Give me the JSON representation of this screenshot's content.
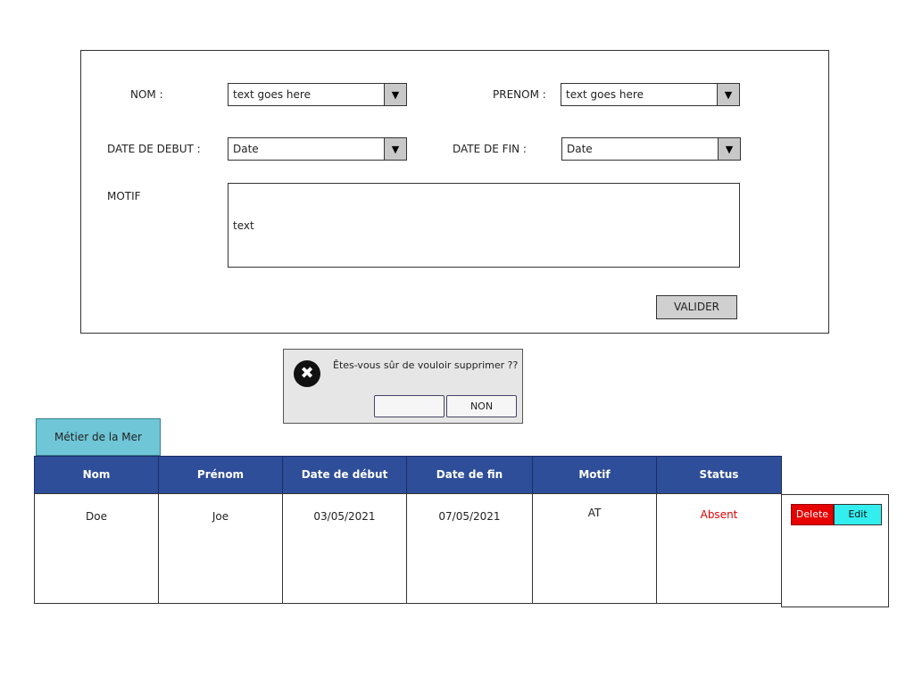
{
  "form": {
    "nom_label": "NOM :",
    "nom_value": "text goes here",
    "prenom_label": "PRENOM :",
    "prenom_value": "text goes here",
    "date_debut_label": "DATE DE DEBUT :",
    "date_debut_value": "Date",
    "date_fin_label": "DATE DE FIN :",
    "date_fin_value": "Date",
    "motif_label": "MOTIF",
    "motif_value": "text",
    "dropdown_arrow": "▼",
    "submit_label": "VALIDER"
  },
  "dialog": {
    "icon": "close-circle-icon",
    "icon_glyph": "✖",
    "message": "Êtes-vous sûr de vouloir supprimer ??",
    "confirm_label": "",
    "cancel_label": "NON"
  },
  "tab": {
    "label": "Métier de la Mer"
  },
  "table": {
    "headers": [
      "Nom",
      "Prénom",
      "Date de début",
      "Date de fin",
      "Motif",
      "Status"
    ],
    "rows": [
      {
        "nom": "Doe",
        "prenom": "Joe",
        "date_debut": "03/05/2021",
        "date_fin": "07/05/2021",
        "motif": "AT",
        "status": "Absent"
      }
    ],
    "status_color": "#e60000",
    "header_color": "#2f4e99"
  },
  "actions": {
    "delete_label": "Delete",
    "edit_label": "Edit"
  }
}
